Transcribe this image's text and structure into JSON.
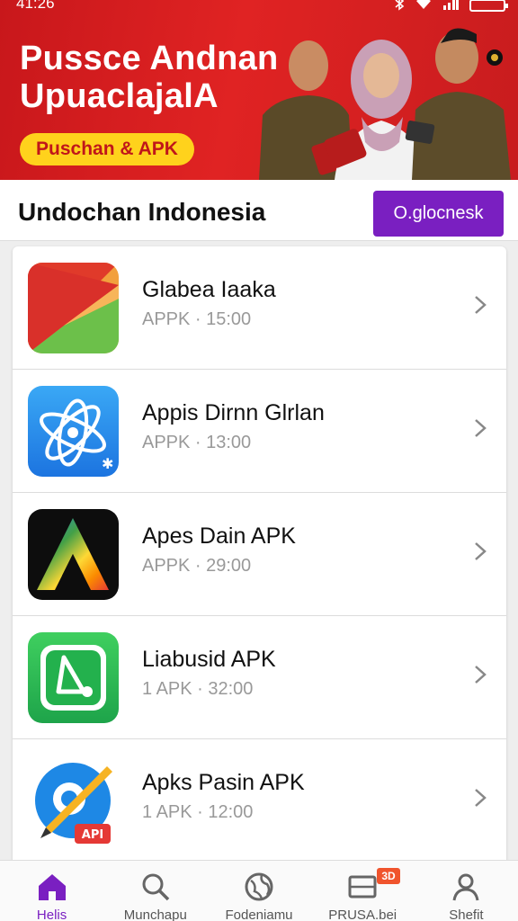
{
  "status_bar": {
    "time": "41:26",
    "icons": [
      "bluetooth-icon",
      "wifi-icon",
      "signal-icon",
      "battery-icon"
    ]
  },
  "banner": {
    "title_line1": "Pussce Andnan",
    "title_line2": "UpuaclajalA",
    "pill_label": "Puschan & APK"
  },
  "header": {
    "title": "Undochan Indonesia",
    "button_label": "O.glocnesk"
  },
  "apps": [
    {
      "name": "Glabea Iaaka",
      "meta": "APPK · 15:00",
      "icon": "orange-red-green-fold-icon"
    },
    {
      "name": "Appis Dirnn Glrlan",
      "meta": "APPK · 13:00",
      "icon": "blue-atom-icon"
    },
    {
      "name": "Apes Dain APK",
      "meta": "APPK · 29:00",
      "icon": "rainbow-a-icon"
    },
    {
      "name": "Liabusid APK",
      "meta": "1 APK · 32:00",
      "icon": "green-triangle-icon"
    },
    {
      "name": "Apks Pasin APK",
      "meta": "1 APK · 12:00",
      "icon": "blue-pencil-api-icon",
      "icon_badge": "API"
    }
  ],
  "nav": {
    "items": [
      {
        "label": "Helis",
        "icon": "home-icon",
        "active": true
      },
      {
        "label": "Munchapu",
        "icon": "search-icon"
      },
      {
        "label": "Fodeniamu",
        "icon": "globe-icon"
      },
      {
        "label": "PRUSA.bei",
        "icon": "tv-icon",
        "badge": "3D"
      },
      {
        "label": "Shefit",
        "icon": "profile-icon"
      }
    ]
  },
  "colors": {
    "banner_red": "#d91e20",
    "accent_purple": "#7a1fc1",
    "pill_yellow": "#ffd21c",
    "badge_orange": "#f0542d"
  }
}
